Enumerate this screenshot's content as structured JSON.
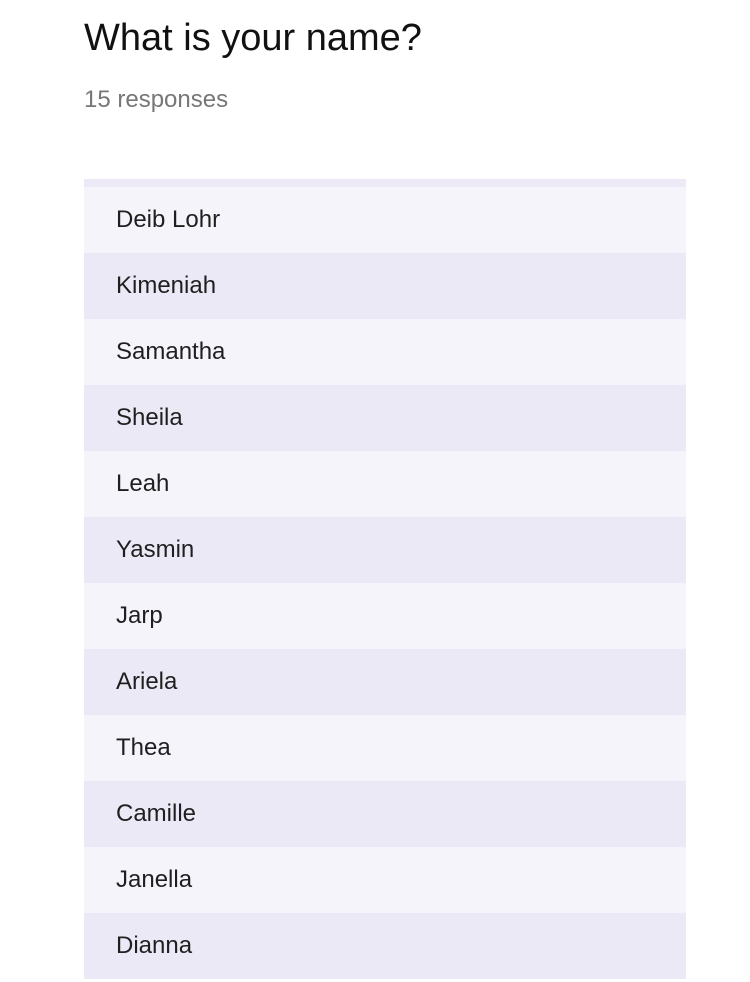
{
  "question": {
    "title": "What is your name?",
    "response_count": "15 responses"
  },
  "responses": [
    "Deib Lohr",
    "Kimeniah",
    "Samantha",
    "Sheila",
    "Leah",
    "Yasmin",
    "Jarp",
    "Ariela",
    "Thea",
    "Camille",
    "Janella",
    "Dianna"
  ],
  "colors": {
    "row_odd": "#f6f4fb",
    "row_even": "#ece9f7",
    "muted_text": "#777777"
  }
}
